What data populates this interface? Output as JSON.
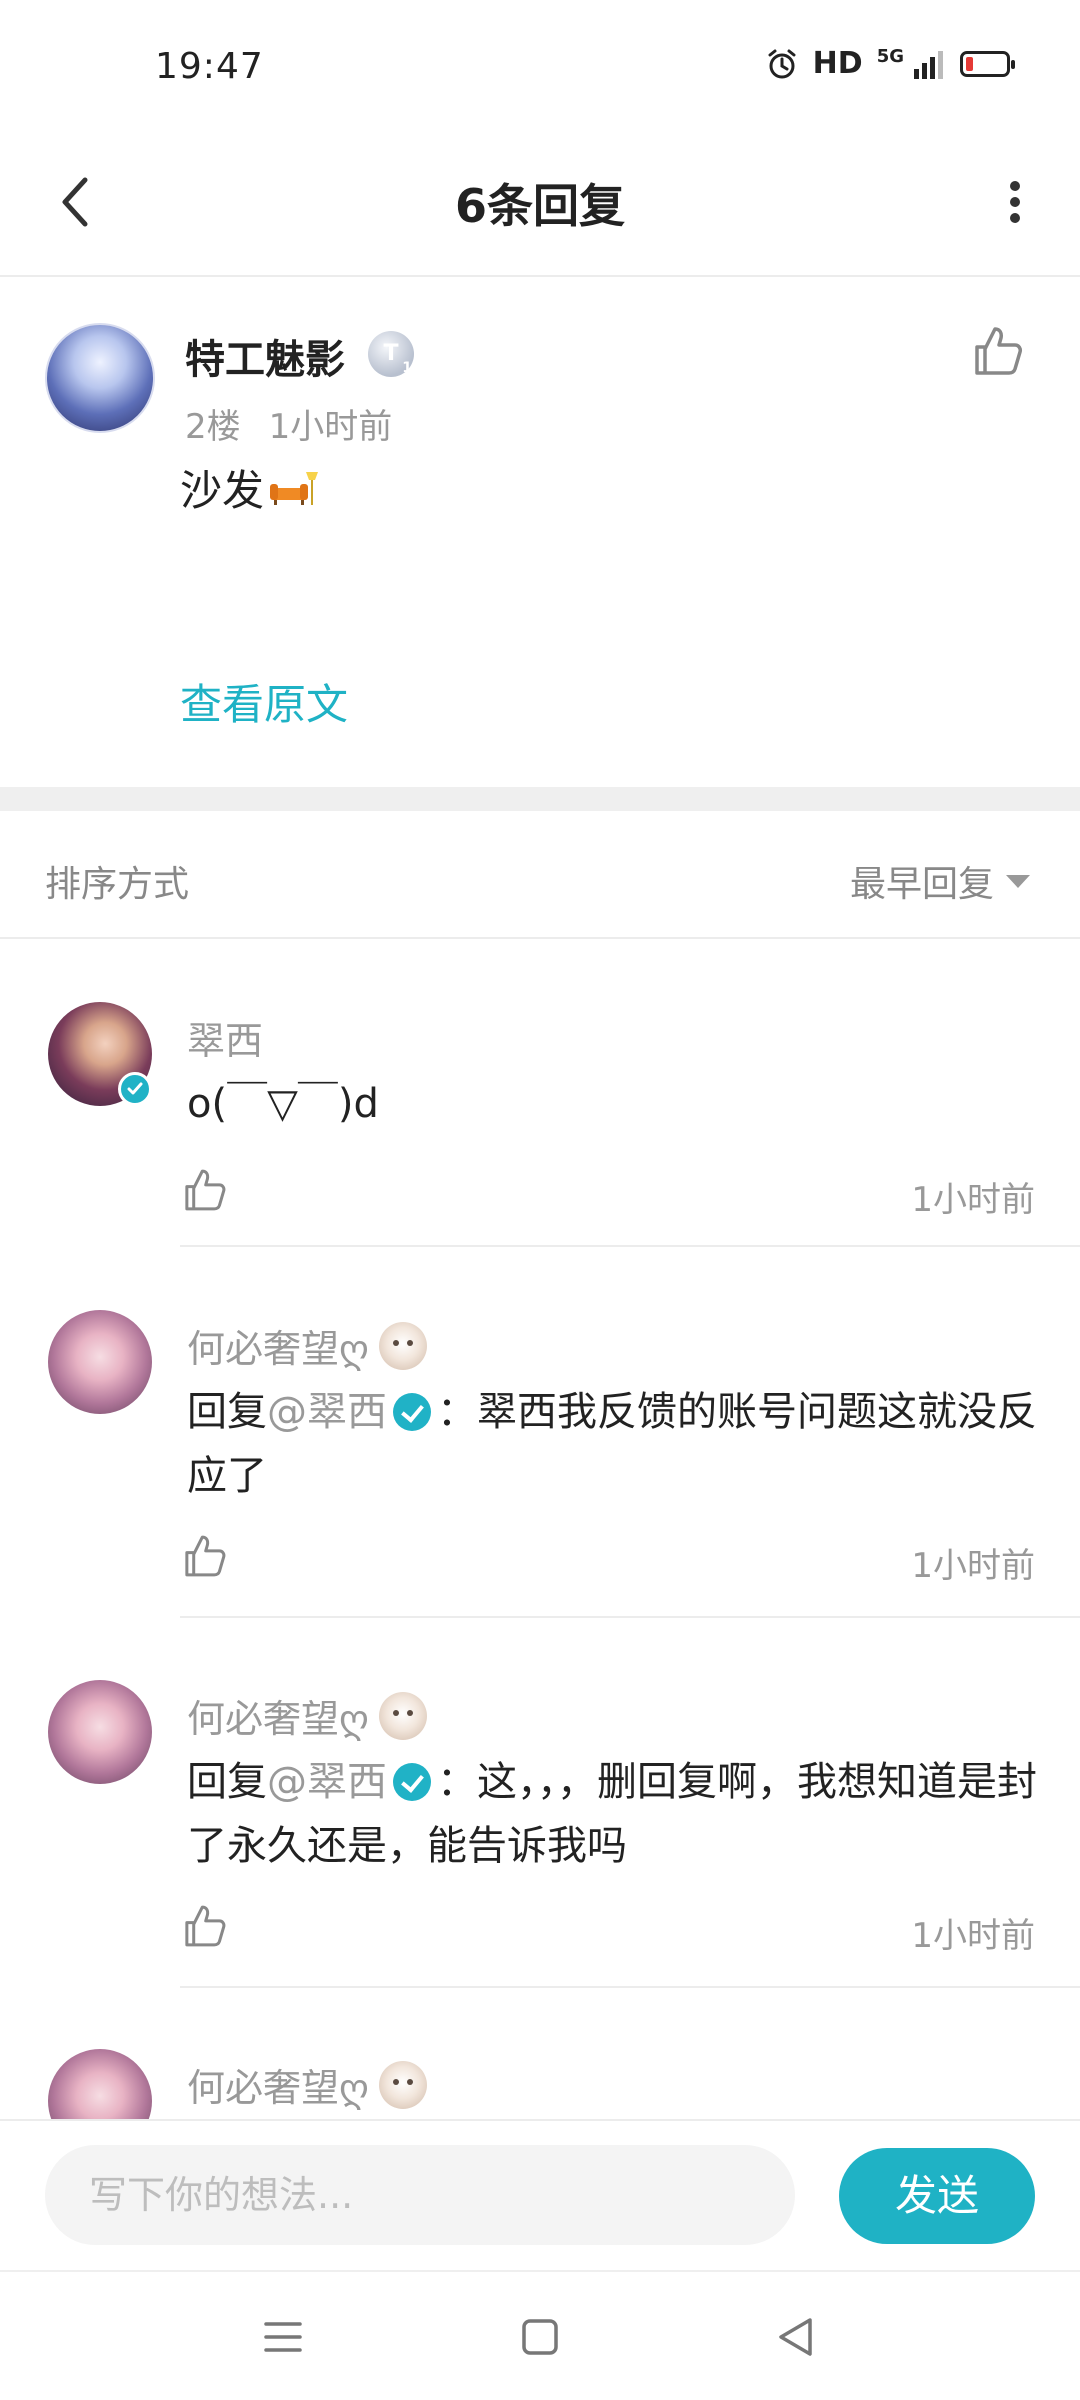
{
  "status_bar": {
    "time": "19:47",
    "hd": "HD",
    "network": "5G",
    "battery_color": "#e53935"
  },
  "header": {
    "title": "6条回复"
  },
  "post": {
    "author": "特工魅影",
    "level_badge": "T",
    "level_num": "1",
    "floor": "2楼",
    "time": "1小时前",
    "content": "沙发",
    "view_original": "查看原文"
  },
  "sort": {
    "label": "排序方式",
    "selected": "最早回复"
  },
  "replies": [
    {
      "author": "翠西",
      "content": "o(￣▽￣)d",
      "time": "1小时前",
      "verified": true
    },
    {
      "author": "何必奢望ღ",
      "reply_prefix": "回复",
      "mention": "@翠西",
      "content": "：翠西我反馈的账号问题这就没反应了",
      "time": "1小时前"
    },
    {
      "author": "何必奢望ღ",
      "reply_prefix": "回复",
      "mention": "@翠西",
      "content": "：这，，，删回复啊，我想知道是封了永久还是，能告诉我吗",
      "time": "1小时前"
    },
    {
      "author": "何必奢望ღ"
    }
  ],
  "composer": {
    "placeholder": "写下你的想法...",
    "send_label": "发送"
  },
  "colors": {
    "accent": "#1fb2c5",
    "muted": "#999999",
    "text": "#222222"
  }
}
